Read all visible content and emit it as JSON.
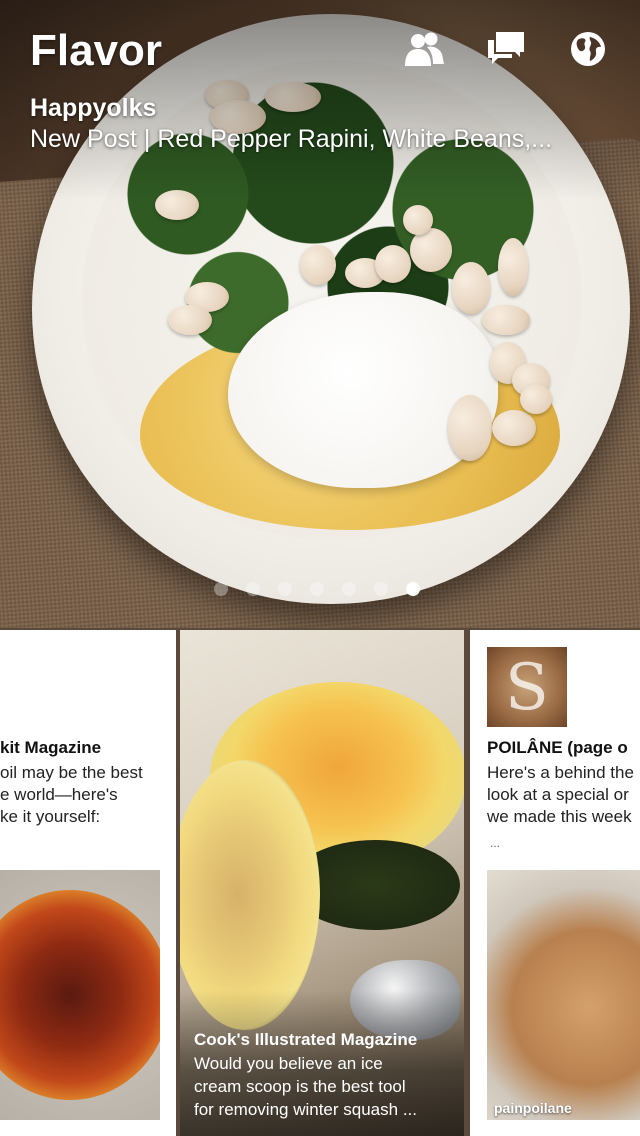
{
  "header": {
    "title": "Flavor",
    "source": "Happyolks",
    "post_title": "New Post | Red Pepper Rapini, White Beans,..."
  },
  "toolbar": {
    "icons": [
      "people-icon",
      "chat-icon",
      "globe-icon"
    ]
  },
  "pagination": {
    "count": 7,
    "active_index": 6
  },
  "cards": {
    "left": {
      "title": "kit Magazine",
      "lines": [
        "oil may be the best",
        "e world—here's",
        "ke it yourself:"
      ]
    },
    "middle": {
      "title": "Cook's Illustrated Magazine",
      "lines": [
        "Would you believe an ice",
        "cream scoop is the best tool",
        "for removing winter squash ..."
      ]
    },
    "right": {
      "title": "POILÂNE (page o",
      "lines": [
        "Here's a behind the",
        "look at a special or",
        "we made this week"
      ],
      "ellipsis": "...",
      "credit": "painpoilane"
    }
  },
  "colors": {
    "text_on_image": "#ffffff",
    "card_bg": "#ffffff",
    "dot_active": "#ffffff"
  }
}
